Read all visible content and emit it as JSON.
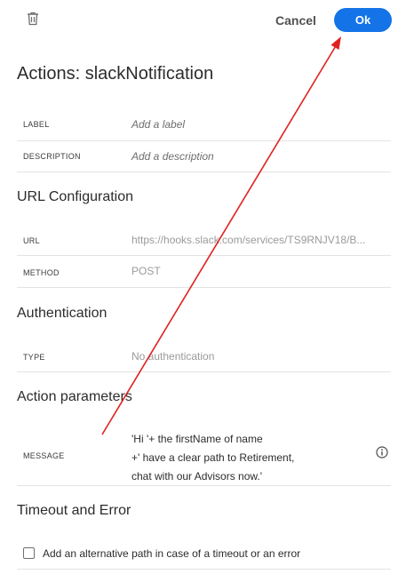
{
  "toolbar": {
    "delete_icon": "trash-icon",
    "cancel_label": "Cancel",
    "ok_label": "Ok"
  },
  "page_title": "Actions: slackNotification",
  "general": {
    "label_field": {
      "label": "LABEL",
      "placeholder": "Add a label"
    },
    "description_field": {
      "label": "DESCRIPTION",
      "placeholder": "Add a description"
    }
  },
  "url_configuration": {
    "title": "URL Configuration",
    "url": {
      "label": "URL",
      "value": "https://hooks.slack.com/services/TS9RNJV18/B..."
    },
    "method": {
      "label": "METHOD",
      "value": "POST"
    }
  },
  "authentication": {
    "title": "Authentication",
    "type": {
      "label": "TYPE",
      "value": "No authentication"
    }
  },
  "action_parameters": {
    "title": "Action parameters",
    "message": {
      "label": "MESSAGE",
      "value": "'Hi '+ the firstName of name\n+' have a clear path to Retirement,\nchat with our Advisors now.'",
      "info_icon": "info-icon"
    }
  },
  "timeout_error": {
    "title": "Timeout and Error",
    "alt_path_label": "Add an alternative path in case of a timeout or an error",
    "alt_path_checked": false
  },
  "colors": {
    "accent": "#1473e6",
    "annotation_arrow": "#e02020"
  }
}
